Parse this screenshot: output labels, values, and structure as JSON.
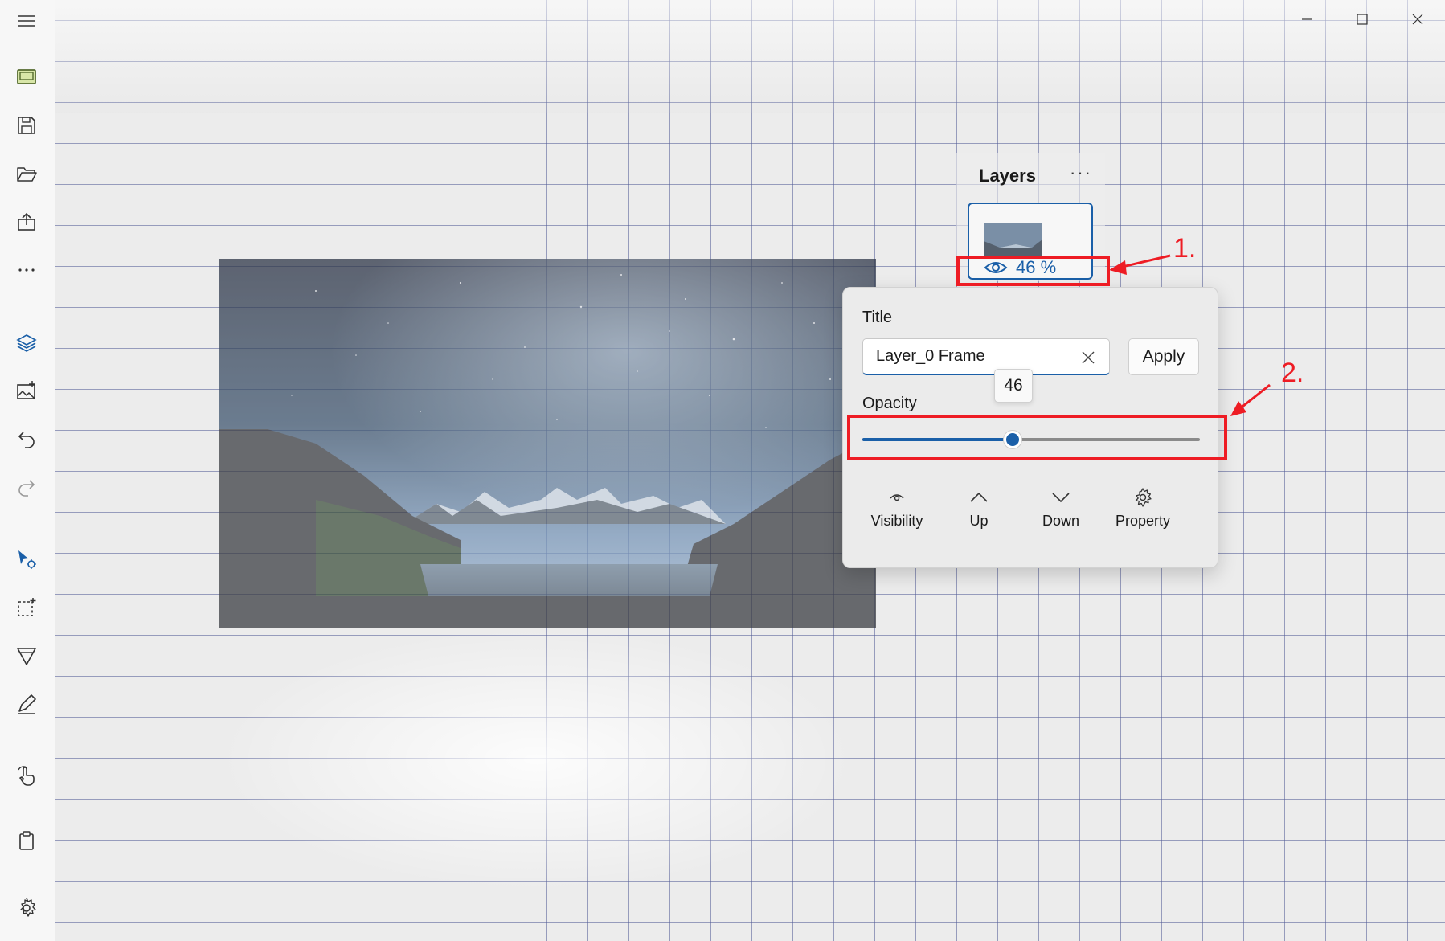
{
  "window": {
    "controls": [
      "minimize",
      "maximize",
      "close"
    ]
  },
  "toolbar": {
    "items": [
      {
        "icon": "hamburger-menu-icon"
      },
      {
        "icon": "frames-icon"
      },
      {
        "icon": "save-icon"
      },
      {
        "icon": "open-folder-icon"
      },
      {
        "icon": "export-icon"
      },
      {
        "icon": "more-dots-icon"
      },
      {
        "icon": "layers-icon"
      },
      {
        "icon": "add-image-icon"
      },
      {
        "icon": "undo-icon"
      },
      {
        "icon": "redo-icon"
      },
      {
        "icon": "select-cursor-icon"
      },
      {
        "icon": "marquee-select-icon"
      },
      {
        "icon": "fill-cone-icon"
      },
      {
        "icon": "pen-icon"
      },
      {
        "icon": "touch-hand-icon"
      },
      {
        "icon": "clipboard-icon"
      },
      {
        "icon": "settings-gear-icon"
      }
    ]
  },
  "layers_panel": {
    "title": "Layers",
    "more": "···",
    "layer": {
      "opacity_display": "46 %"
    }
  },
  "flyout": {
    "title_label": "Title",
    "title_value": "Layer_0 Frame",
    "apply_label": "Apply",
    "opacity_label": "Opacity",
    "opacity_value": 46,
    "opacity_tooltip": "46",
    "actions": [
      {
        "label": "Visibility",
        "icon": "eye-small-icon"
      },
      {
        "label": "Up",
        "icon": "chevron-up-icon"
      },
      {
        "label": "Down",
        "icon": "chevron-down-icon"
      },
      {
        "label": "Property",
        "icon": "gear-icon"
      }
    ]
  },
  "annotations": {
    "label_1": "1.",
    "label_2": "2.",
    "color": "#ee1c24"
  },
  "colors": {
    "accent": "#1a5fa8",
    "annotation_red": "#ee1c24",
    "grid_line": "#505a96"
  }
}
